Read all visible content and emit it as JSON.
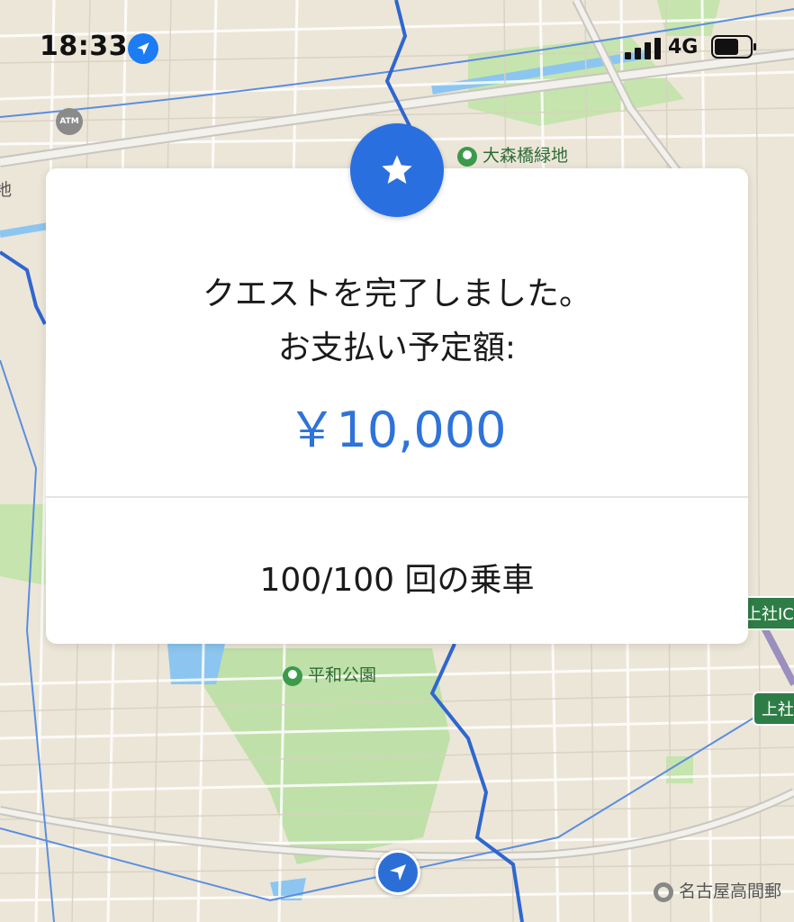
{
  "status_bar": {
    "time": "18:33",
    "network": "4G"
  },
  "map": {
    "labels": {
      "park_top": "大森橋緑地",
      "park_bottom": "平和公園",
      "post_office": "名古屋高間郵",
      "ic_right": "上社IC",
      "ic_right_2": "上社",
      "atm": "ATM",
      "left_edge": "地"
    }
  },
  "quest_card": {
    "message_line1": "クエストを完了しました。",
    "message_line2": "お支払い予定額:",
    "amount": "￥10,000",
    "rides_progress": "100/100 回の乗車"
  },
  "colors": {
    "accent": "#2e73d9",
    "badge": "#2a6fe0",
    "route": "#2f66d0"
  },
  "icons": {
    "badge": "star-icon",
    "location": "location-arrow-icon",
    "current_position": "navigation-arrow-icon"
  }
}
